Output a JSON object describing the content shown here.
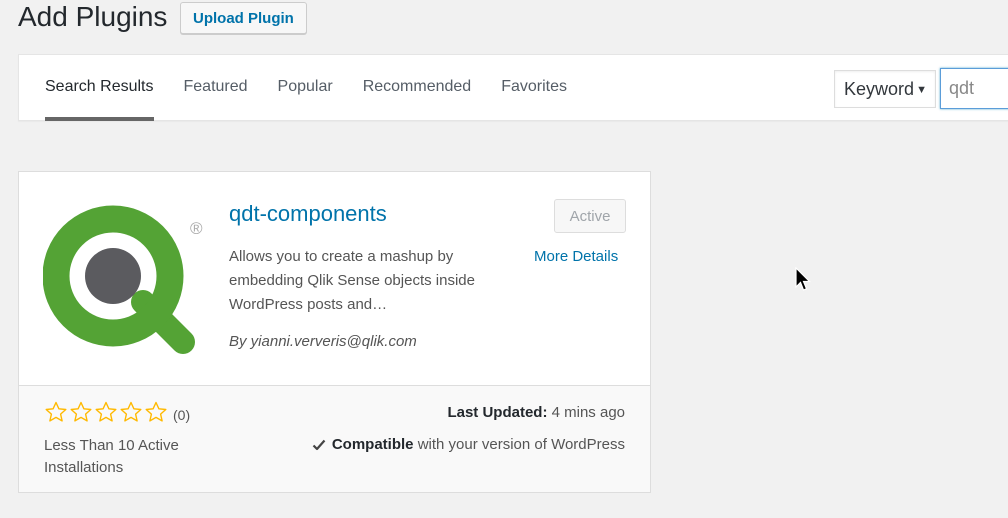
{
  "header": {
    "title": "Add Plugins",
    "upload_label": "Upload Plugin"
  },
  "tabs": [
    {
      "label": "Search Results",
      "current": true
    },
    {
      "label": "Featured"
    },
    {
      "label": "Popular"
    },
    {
      "label": "Recommended"
    },
    {
      "label": "Favorites"
    }
  ],
  "search": {
    "type_selected": "Keyword",
    "value": "qdt"
  },
  "plugin": {
    "name": "qdt-components",
    "description": "Allows you to create a mashup by embedding Qlik Sense objects inside WordPress posts and…",
    "author": "By yianni.ververis@qlik.com",
    "action_label": "Active",
    "more_details_label": "More Details",
    "rating_stars": 0,
    "rating_count": "(0)",
    "installs": "Less Than 10 Active Installations",
    "last_updated_label": "Last Updated:",
    "last_updated_value": "4 mins ago",
    "compatible_label": "Compatible",
    "compatible_text": "with your version of WordPress",
    "icon": "qlik-logo-icon",
    "registered_mark": "®"
  },
  "colors": {
    "accent": "#0073aa",
    "qlik_green": "#54a335",
    "qlik_gray": "#5b5b5f",
    "star": "#ffb900"
  }
}
